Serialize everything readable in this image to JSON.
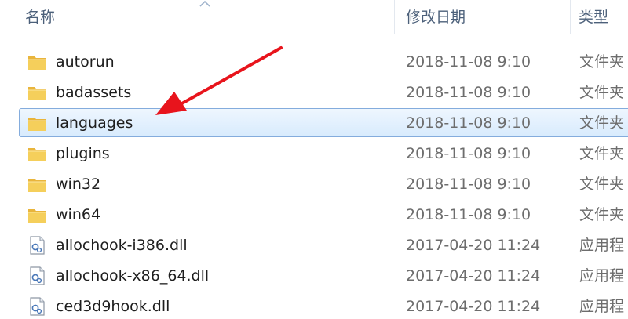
{
  "header": {
    "name_label": "名称",
    "date_label": "修改日期",
    "type_label": "类型"
  },
  "files": [
    {
      "name": "autorun",
      "date": "2018-11-08 9:10",
      "type": "文件夹",
      "icon": "folder-icon",
      "selected": false
    },
    {
      "name": "badassets",
      "date": "2018-11-08 9:10",
      "type": "文件夹",
      "icon": "folder-icon",
      "selected": false
    },
    {
      "name": "languages",
      "date": "2018-11-08 9:10",
      "type": "文件夹",
      "icon": "folder-icon",
      "selected": true
    },
    {
      "name": "plugins",
      "date": "2018-11-08 9:10",
      "type": "文件夹",
      "icon": "folder-icon",
      "selected": false
    },
    {
      "name": "win32",
      "date": "2018-11-08 9:10",
      "type": "文件夹",
      "icon": "folder-icon",
      "selected": false
    },
    {
      "name": "win64",
      "date": "2018-11-08 9:10",
      "type": "文件夹",
      "icon": "folder-icon",
      "selected": false
    },
    {
      "name": "allochook-i386.dll",
      "date": "2017-04-20 11:24",
      "type": "应用程",
      "icon": "dll-file-icon",
      "selected": false
    },
    {
      "name": "allochook-x86_64.dll",
      "date": "2017-04-20 11:24",
      "type": "应用程",
      "icon": "dll-file-icon",
      "selected": false
    },
    {
      "name": "ced3d9hook.dll",
      "date": "2017-04-20 11:24",
      "type": "应用程",
      "icon": "dll-file-icon",
      "selected": false
    }
  ],
  "colors": {
    "selection_border": "#84acdd",
    "annotation_arrow": "#e8141c",
    "folder_yellow": "#f3c64a"
  }
}
